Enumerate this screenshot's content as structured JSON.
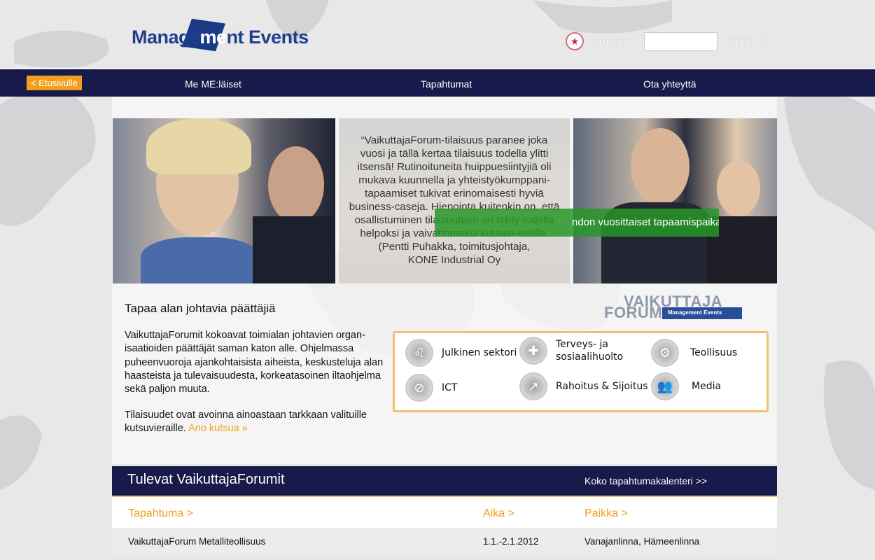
{
  "header": {
    "logo_text_a": "Manage",
    "logo_text_me": "me",
    "logo_text_b": "nt Events",
    "login_label": "Kutsuvieraat",
    "login_input_value": "",
    "login_link": "Kirjaudu >>",
    "login_icon": "star-icon"
  },
  "nav": {
    "back_label": "< Etusivulle",
    "items": [
      {
        "label": "Me ME:läiset"
      },
      {
        "label": "Tapahtumat"
      },
      {
        "label": "Ota yhteyttä"
      }
    ]
  },
  "hero": {
    "quote": "“VaikuttajaForum-tilaisuus paranee joka vuosi ja tällä kertaa tilaisuus todella ylitti itsensä! Rutinoituneita huippuesiintyjiä oli mukava kuunnella ja yhteistyökumppani-tapaamiset tukivat erinomaisesti hyviä business-caseja. Hienointa kuitenkin on, että osallistuminen tilaisuuteen on tehty todella helpoksi ja vaivattomaksi kutsuvi-eraille.",
    "quote_attribution_1": "(Pentti Puhakka, toimitusjohtaja,",
    "quote_attribution_2": "KONE Industrial Oy",
    "banner_text": "ndon vuosittaiset tapaamispaikat"
  },
  "intro": {
    "title": "Tapaa alan johtavia päättäjiä",
    "paragraph_1": "VaikuttajaForumit kokoavat toimialan johtavien organ-isaatioiden päättäjät saman katon alle. Ohjelmassa puheenvuoroja ajankohtaisista aiheista, keskusteluja alan haasteista ja tulevaisuudesta, korkeatasoinen iltaohjelma sekä paljon muuta.",
    "paragraph_2": "Tilaisuudet ovat avoinna ainoastaan tarkkaan valituille kutsuvieraille.",
    "invite_link": "Ano kutsua »"
  },
  "forum_logo": {
    "line_1": "VAIKUTTAJA",
    "line_2": "FORUM",
    "tag": "Management Events"
  },
  "sectors": [
    {
      "label": "Julkinen sektori",
      "icon": "lion-emblem-icon"
    },
    {
      "label": "Terveys- ja sosiaalihuolto",
      "icon": "health-cross-icon"
    },
    {
      "label": "Teollisuus",
      "icon": "gears-icon"
    },
    {
      "label": "ICT",
      "icon": "satellite-icon"
    },
    {
      "label": "Rahoitus & Sijoitus",
      "icon": "chart-icon"
    },
    {
      "label": "Media",
      "icon": "people-icon"
    }
  ],
  "events": {
    "title": "Tulevat VaikuttajaForumit",
    "calendar_link": "Koko tapahtumakalenteri >>",
    "columns": [
      "Tapahtuma >",
      "Aika >",
      "Paikka >"
    ],
    "rows": [
      {
        "event": "VaikuttajaForum Metalliteollisuus",
        "time": "1.1.-2.1.2012",
        "place": "Vanajanlinna, Hämeenlinna"
      }
    ]
  },
  "colors": {
    "navy": "#171a4a",
    "orange": "#f0a01c",
    "green": "#289628",
    "brand_blue": "#1f3f8c"
  }
}
